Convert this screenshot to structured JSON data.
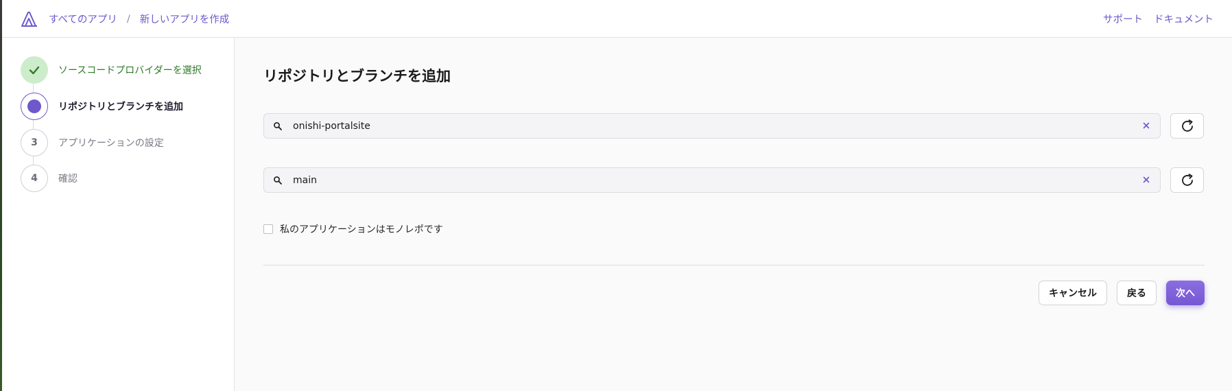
{
  "header": {
    "breadcrumbs": [
      "すべてのアプリ",
      "新しいアプリを作成"
    ],
    "separator": "/",
    "links": [
      "サポート",
      "ドキュメント"
    ]
  },
  "steps": [
    {
      "number": "1",
      "label": "ソースコードプロバイダーを選択",
      "status": "done"
    },
    {
      "number": "2",
      "label": "リポジトリとブランチを追加",
      "status": "current"
    },
    {
      "number": "3",
      "label": "アプリケーションの設定",
      "status": "todo"
    },
    {
      "number": "4",
      "label": "確認",
      "status": "todo"
    }
  ],
  "main": {
    "title": "リポジトリとブランチを追加",
    "repository": {
      "value": "onishi-portalsite"
    },
    "branch": {
      "value": "main"
    },
    "monorepo_label": "私のアプリケーションはモノレポです",
    "monorepo_checked": false
  },
  "actions": {
    "cancel": "キャンセル",
    "back": "戻る",
    "next": "次へ"
  },
  "colors": {
    "accent": "#6e58cc",
    "done_bg": "#cdeccb",
    "done_text": "#2f7a2a"
  }
}
